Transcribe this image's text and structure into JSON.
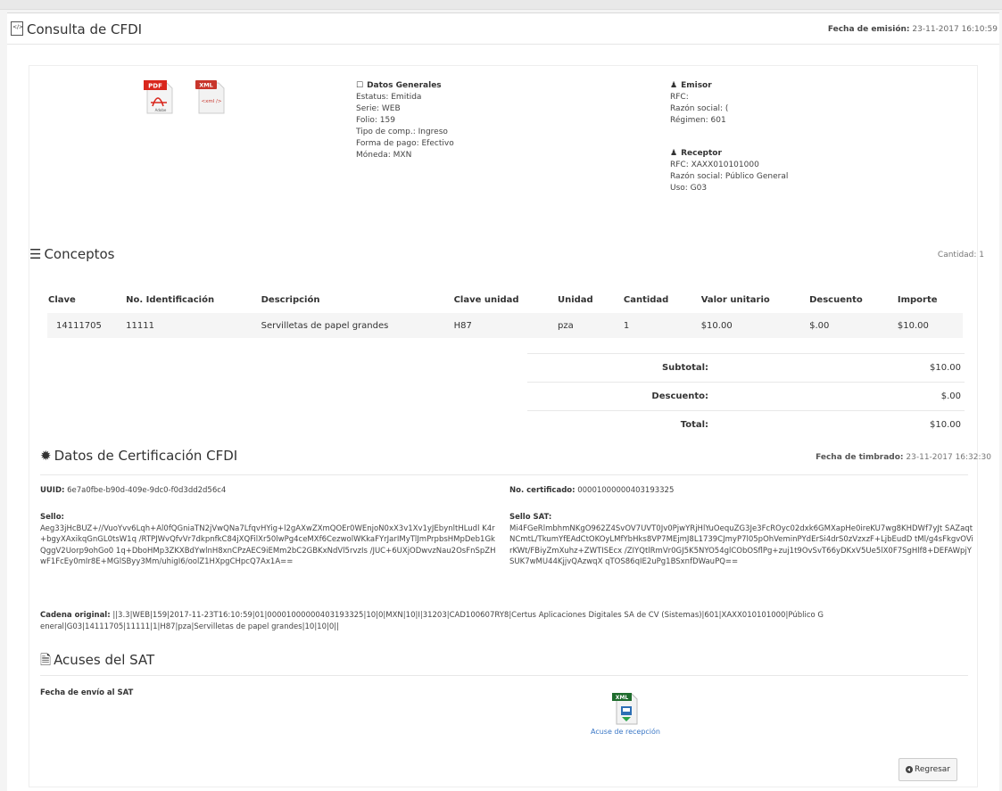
{
  "header": {
    "title": "Consulta de CFDI",
    "fecha_emision_label": "Fecha de emisión:",
    "fecha_emision_value": "23-11-2017 16:10:59"
  },
  "icons": {
    "pdf": "pdf-file-icon",
    "xml": "xml-file-icon"
  },
  "datos_generales": {
    "title": "Datos Generales",
    "lines": [
      "Estatus: Emitida",
      "Serie: WEB",
      "Folio: 159",
      "Tipo de comp.: Ingreso",
      "Forma de pago: Efectivo",
      "Móneda: MXN"
    ]
  },
  "emisor": {
    "title": "Emisor",
    "lines": [
      "RFC:",
      "Razón social: (",
      "Régimen: 601"
    ]
  },
  "receptor": {
    "title": "Receptor",
    "lines": [
      "RFC: XAXX010101000",
      "Razón social: Público General",
      "Uso: G03"
    ]
  },
  "conceptos": {
    "title": "Conceptos",
    "cantidad_label": "Cantidad: 1",
    "columns": [
      "Clave",
      "No. Identificación",
      "Descripción",
      "Clave unidad",
      "Unidad",
      "Cantidad",
      "Valor unitario",
      "Descuento",
      "Importe"
    ],
    "rows": [
      [
        "14111705",
        "11111",
        "Servilletas de papel grandes",
        "H87",
        "pza",
        "1",
        "$10.00",
        "$.00",
        "$10.00"
      ]
    ],
    "totals": [
      {
        "label": "Subtotal:",
        "value": "$10.00"
      },
      {
        "label": "Descuento:",
        "value": "$.00"
      },
      {
        "label": "Total:",
        "value": "$10.00"
      }
    ]
  },
  "certificacion": {
    "title": "Datos de Certificación CFDI",
    "fecha_timbrado_label": "Fecha de timbrado:",
    "fecha_timbrado_value": "23-11-2017 16:32:30",
    "uuid_label": "UUID:",
    "uuid_value": "6e7a0fbe-b90d-409e-9dc0-f0d3dd2d56c4",
    "no_cert_label": "No. certificado:",
    "no_cert_value": "00001000000403193325",
    "sello_label": "Sello:",
    "sello_value": "Aeg33jHcBUZ+//VuoYvv6Lqh+Al0fQGniaTN2jVwQNa7LfqvHYig+l2gAXwZXmQOEr0WEnjoN0xX3v1Xv1yJEbynltHLudl K4r+bgyXAxikqGnGL0tsW1q /RTPJWvQfvVr7dkpnfkC84jXQFilXr50lwPg4ceMXf6CezwolWKkaFYrJarIMyTlJmPrpbsHMpDeb1GkQggV2Uorp9ohGo0 1q+DboHMp3ZKXBdYwlnH8xnCPzAEC9iEMm2bC2GBKxNdVl5rvzIs /JUC+6UXjODwvzNau2OsFnSpZHwF1FcEy0mIr8E+MGlSByy3Mm/uhigI6/oolZ1HXpgCHpcQ7Ax1A==",
    "sello_sat_label": "Sello SAT:",
    "sello_sat_value": "Mi4FGeRlmbhmNKgO962Z4SvOV7UVT0Jv0PjwYRjHlYuOequZG3Je3FcROyc02dxk6GMXapHe0ireKU7wg8KHDWf7yJt SAZaqtNCmtL/TkumYfEAdCtOKOyLMfYbHks8VP7MEjmJ8L1739CJmyP7l05pOhVeminPYdErSi4drS0zVzxzF+LjbEudD tMl/g4sFkgvOVirKWt/FBiyZmXuhz+ZWTISEcx /ZIYQtlRmVr0GJ5K5NYO54glCObOSflPg+zuj1t9OvSvT66yDKxV5Ue5lX0F7SgHlf8+DEFAWpjYSUK7wMU44KjjvQAzwqX qTOS86qIE2uPg1BSxnfDWauPQ==",
    "cadena_label": "Cadena original:",
    "cadena_value": "||3.3|WEB|159|2017-11-23T16:10:59|01|00001000000403193325|10|0|MXN|10|I|31203|CAD100607RY8|Certus Aplicaciones Digitales SA de CV (Sistemas)|601|XAXX010101000|Público General|G03|14111705|11111|1|H87|pza|Servilletas de papel grandes|10|10|0||"
  },
  "acuses": {
    "title": "Acuses del SAT",
    "fecha_envio_label": "Fecha de envío al SAT",
    "acuse_label": "Acuse de recepción"
  },
  "button": {
    "regresar": "Regresar"
  }
}
